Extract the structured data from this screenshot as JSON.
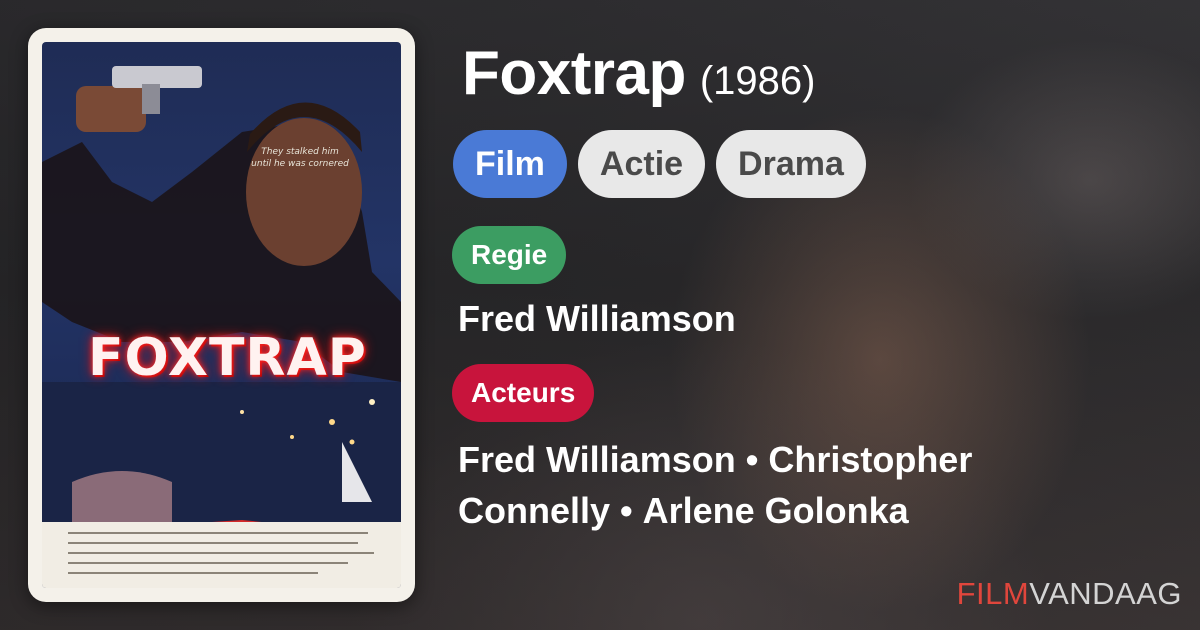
{
  "movie": {
    "title": "Foxtrap",
    "year": "(1986)",
    "poster_title": "FOXTRAP"
  },
  "tags": [
    {
      "label": "Film",
      "primary": true
    },
    {
      "label": "Actie",
      "primary": false
    },
    {
      "label": "Drama",
      "primary": false
    }
  ],
  "director": {
    "label": "Regie",
    "name": "Fred Williamson"
  },
  "cast": {
    "label": "Acteurs",
    "names": [
      "Fred Williamson",
      "Christopher Connelly",
      "Arlene Golonka"
    ],
    "separator": "•"
  },
  "logo": {
    "part1": "FILM",
    "part2": "VANDAAG"
  },
  "colors": {
    "film_tag": "#4a7ad6",
    "genre_tag": "#e8e8e8",
    "regie_badge": "#3c9d62",
    "actors_badge": "#c8143c",
    "logo_accent": "#e0463c"
  }
}
